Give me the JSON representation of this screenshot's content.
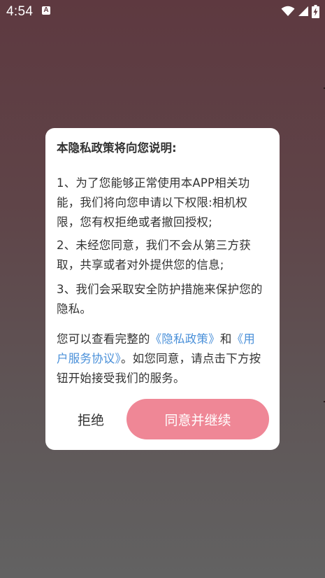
{
  "status_bar": {
    "time": "4:54",
    "notification_letter": "A",
    "icons": [
      "wifi-icon",
      "cellular-signal-icon",
      "battery-charging-icon"
    ]
  },
  "dialog": {
    "title": "本隐私政策将向您说明:",
    "paragraph_1": "1、为了您能够正常使用本APP相关功能，我们将向您申请以下权限:相机权限，您有权拒绝或者撤回授权;",
    "paragraph_2": "2、未经您同意，我们不会从第三方获取，共享或者对外提供您的信息;",
    "paragraph_3": "3、我们会采取安全防护措施来保护您的隐私。",
    "paragraph_4": {
      "prefix": "您可以查看完整的",
      "privacy_policy_link": "《隐私政策》",
      "conjunction": "和",
      "user_agreement_link": "《用户服务协议》",
      "suffix": "。如您同意，请点击下方按钮开始接受我们的服务。"
    },
    "refuse_button": "拒绝",
    "agree_button": "同意并继续"
  },
  "colors": {
    "background_top": "#5e3940",
    "background_bottom": "#626262",
    "dialog_background": "#ffffff",
    "link": "#4a90d9",
    "agree_button": "#ef8796",
    "text": "#333333"
  }
}
